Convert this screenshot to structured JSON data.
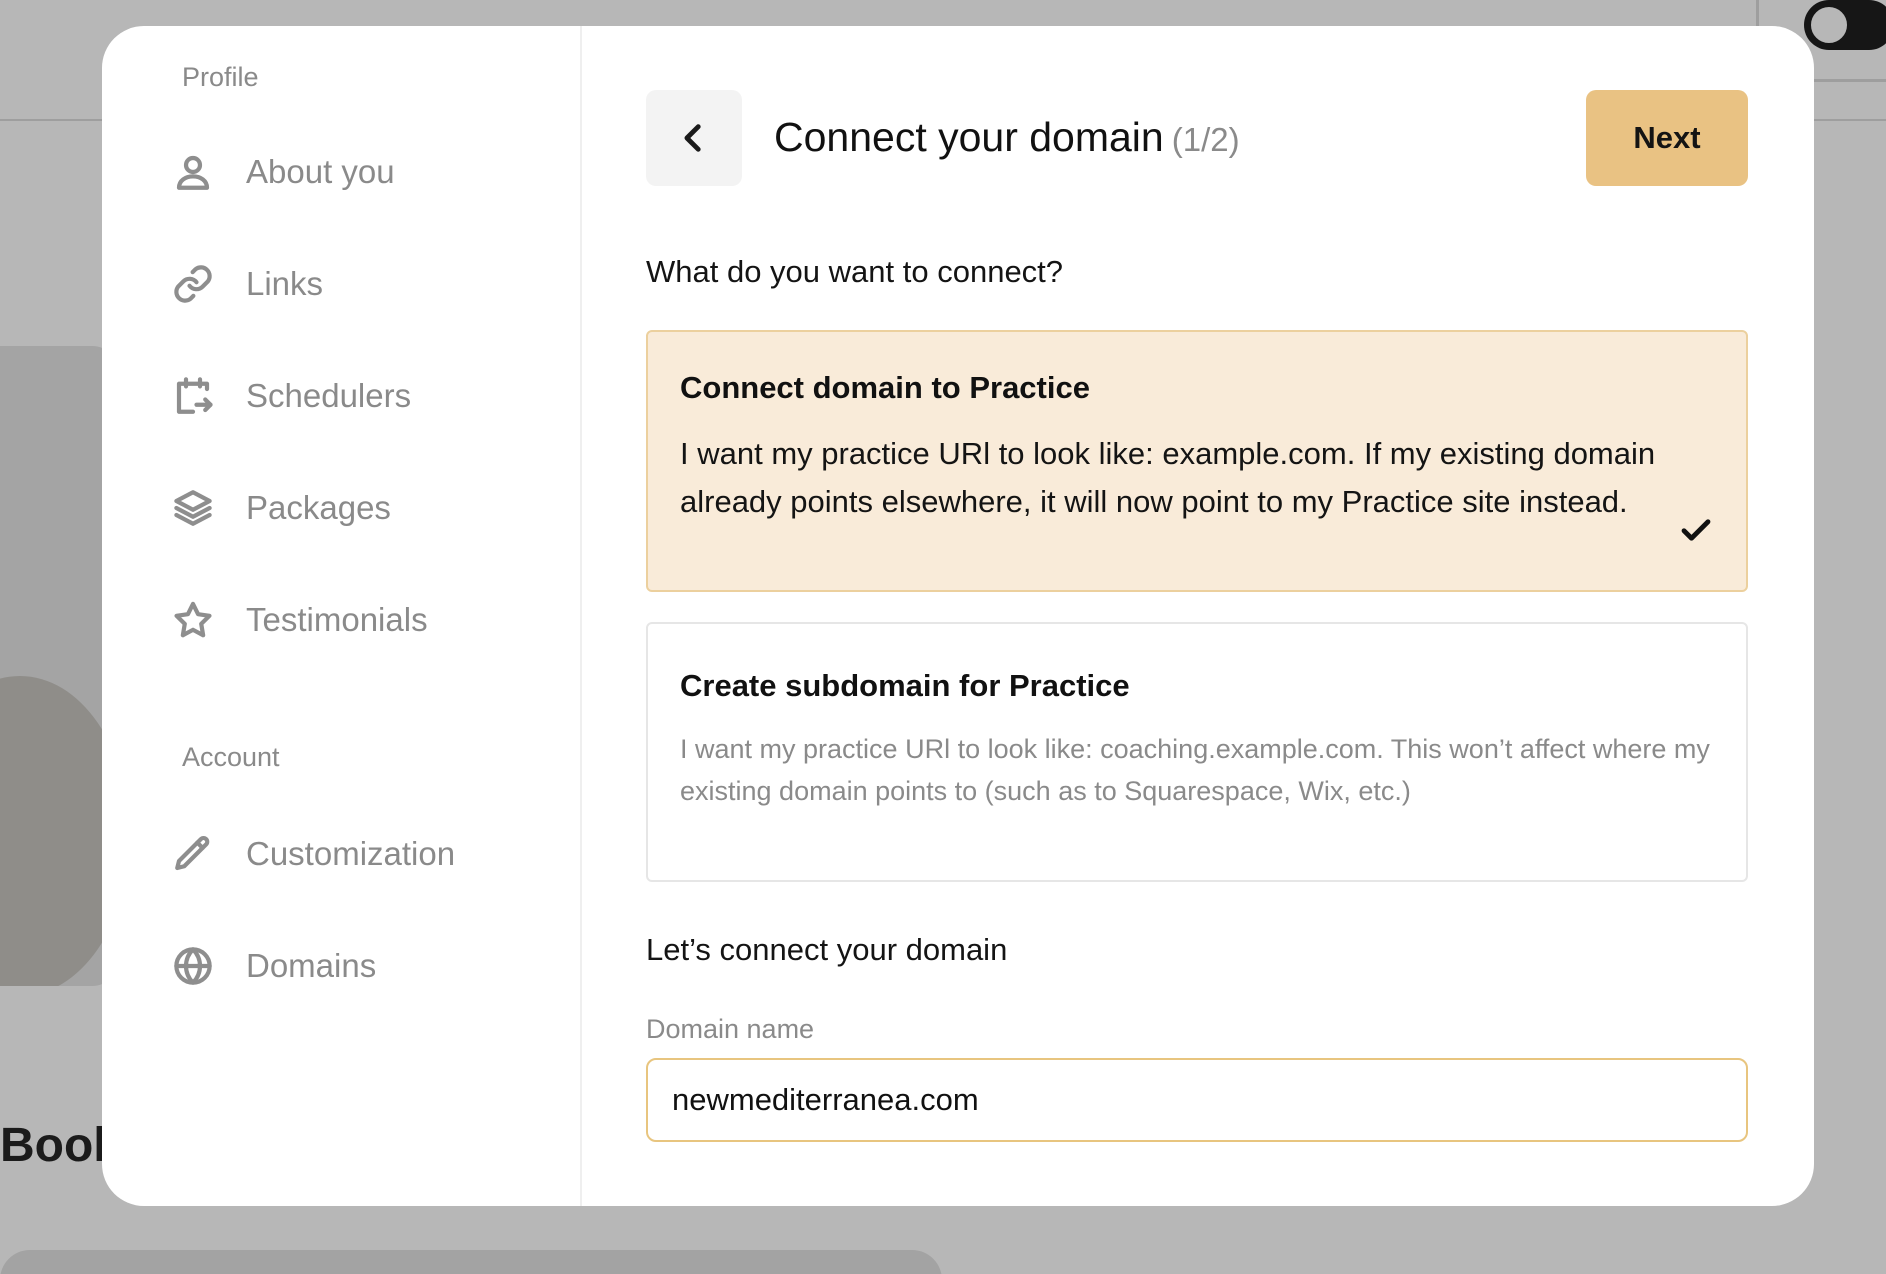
{
  "background": {
    "heading": "Book"
  },
  "sidebar": {
    "profile_label": "Profile",
    "profile_items": [
      {
        "label": "About you",
        "icon": "user-icon"
      },
      {
        "label": "Links",
        "icon": "link-icon"
      },
      {
        "label": "Schedulers",
        "icon": "calendar-arrow-icon"
      },
      {
        "label": "Packages",
        "icon": "layers-icon"
      },
      {
        "label": "Testimonials",
        "icon": "star-icon"
      }
    ],
    "account_label": "Account",
    "account_items": [
      {
        "label": "Customization",
        "icon": "pencil-icon"
      },
      {
        "label": "Domains",
        "icon": "globe-icon"
      }
    ]
  },
  "main": {
    "title": "Connect your domain",
    "step": "(1/2)",
    "next_label": "Next",
    "question": "What do you want to connect?",
    "options": [
      {
        "title": "Connect domain to Practice",
        "description": "I want my practice URl to look like: example.com. If my existing domain already points elsewhere, it will now point to my Practice site instead.",
        "selected": true
      },
      {
        "title": "Create subdomain for Practice",
        "description": "I want my practice URl to look like: coaching.example.com. This won’t affect where my existing domain points to (such as to Squarespace, Wix, etc.)",
        "selected": false
      }
    ],
    "subheading": "Let’s connect your domain",
    "domain_field": {
      "label": "Domain name",
      "value": "newmediterranea.com"
    }
  },
  "colors": {
    "accent": "#e9c283",
    "selected_bg": "#f9ebd9",
    "selected_border": "#ecd09e",
    "input_border": "#e8c57f",
    "muted_text": "#8a8a8a",
    "overlay": "#b7b7b7"
  }
}
